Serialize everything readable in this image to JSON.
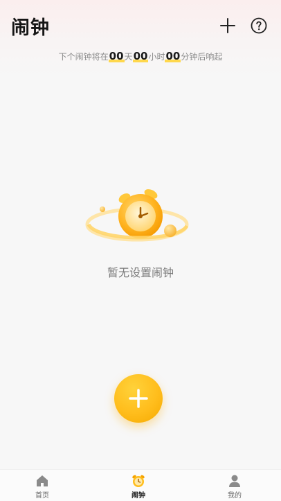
{
  "header": {
    "title": "闹钟",
    "add_icon": "plus-icon",
    "help_icon": "question-circle-icon"
  },
  "countdown": {
    "prefix": "下个闹钟将在",
    "days": "00",
    "days_unit": "天",
    "hours": "00",
    "hours_unit": "小时",
    "minutes": "00",
    "minutes_unit": "分钟后响起"
  },
  "empty_state": {
    "illustration": "alarm-clock-illustration",
    "message": "暂无设置闹钟"
  },
  "fab": {
    "icon": "plus-icon"
  },
  "bottom_nav": {
    "items": [
      {
        "label": "首页",
        "icon": "home-icon",
        "active": false
      },
      {
        "label": "闹钟",
        "icon": "alarm-clock-icon",
        "active": true
      },
      {
        "label": "我的",
        "icon": "user-icon",
        "active": false
      }
    ]
  },
  "colors": {
    "accent": "#ffbd1c",
    "highlight_underline": "#ffd84d",
    "title_text": "#161616",
    "muted_text": "#8a8a8a"
  }
}
